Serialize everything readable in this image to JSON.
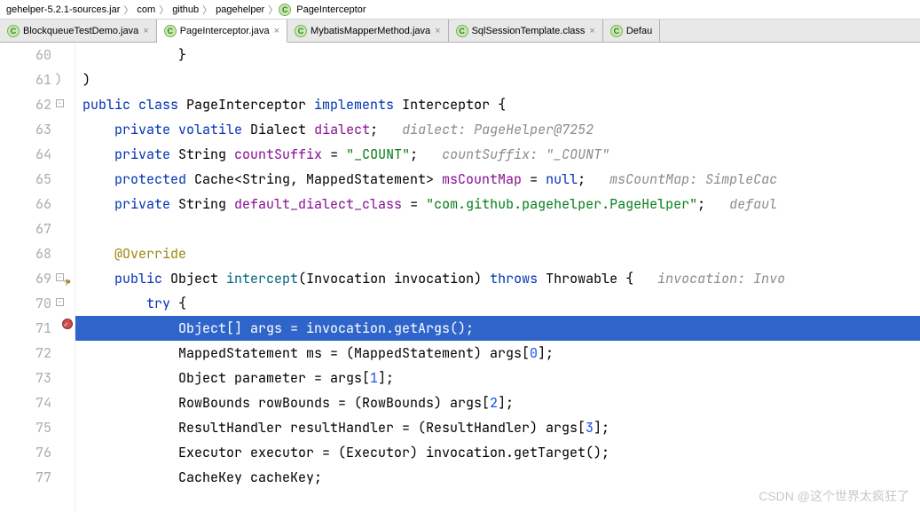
{
  "breadcrumb": {
    "items": [
      "gehelper-5.2.1-sources.jar",
      "com",
      "github",
      "pagehelper",
      "PageInterceptor"
    ]
  },
  "tabs": [
    {
      "label": "BlockqueueTestDemo.java",
      "active": false
    },
    {
      "label": "PageInterceptor.java",
      "active": true
    },
    {
      "label": "MybatisMapperMethod.java",
      "active": false
    },
    {
      "label": "SqlSessionTemplate.class",
      "active": false
    },
    {
      "label": "Defau",
      "active": false,
      "truncated": true
    }
  ],
  "lines": {
    "60": {
      "indent": 12,
      "tokens": [
        {
          "t": "}",
          "c": ""
        }
      ]
    },
    "61": {
      "indent": 0,
      "closer": ")",
      "tokens": [
        {
          "t": ")",
          "c": ""
        }
      ]
    },
    "62": {
      "indent": 0,
      "tokens": [
        {
          "t": "public ",
          "c": "kw"
        },
        {
          "t": "class ",
          "c": "kw"
        },
        {
          "t": "PageInterceptor ",
          "c": "type"
        },
        {
          "t": "implements ",
          "c": "kw"
        },
        {
          "t": "Interceptor ",
          "c": "type"
        },
        {
          "t": "{",
          "c": ""
        }
      ]
    },
    "63": {
      "indent": 4,
      "tokens": [
        {
          "t": "private ",
          "c": "kw"
        },
        {
          "t": "volatile ",
          "c": "kw"
        },
        {
          "t": "Dialect ",
          "c": "type"
        },
        {
          "t": "dialect",
          "c": "field"
        },
        {
          "t": ";   ",
          "c": ""
        },
        {
          "t": "dialect: PageHelper@7252",
          "c": "cmt"
        }
      ]
    },
    "64": {
      "indent": 4,
      "tokens": [
        {
          "t": "private ",
          "c": "kw"
        },
        {
          "t": "String ",
          "c": "type"
        },
        {
          "t": "countSuffix",
          "c": "field"
        },
        {
          "t": " = ",
          "c": ""
        },
        {
          "t": "\"_COUNT\"",
          "c": "str"
        },
        {
          "t": ";   ",
          "c": ""
        },
        {
          "t": "countSuffix: \"_COUNT\"",
          "c": "cmt"
        }
      ]
    },
    "65": {
      "indent": 4,
      "tokens": [
        {
          "t": "protected ",
          "c": "kw"
        },
        {
          "t": "Cache<String, MappedStatement> ",
          "c": "type"
        },
        {
          "t": "msCountMap",
          "c": "field"
        },
        {
          "t": " = ",
          "c": ""
        },
        {
          "t": "null",
          "c": "kw"
        },
        {
          "t": ";   ",
          "c": ""
        },
        {
          "t": "msCountMap: SimpleCac",
          "c": "cmt"
        }
      ]
    },
    "66": {
      "indent": 4,
      "tokens": [
        {
          "t": "private ",
          "c": "kw"
        },
        {
          "t": "String ",
          "c": "type"
        },
        {
          "t": "default_dialect_class",
          "c": "field"
        },
        {
          "t": " = ",
          "c": ""
        },
        {
          "t": "\"com.github.pagehelper.PageHelper\"",
          "c": "str"
        },
        {
          "t": ";   ",
          "c": ""
        },
        {
          "t": "defaul",
          "c": "cmt"
        }
      ]
    },
    "67": {
      "indent": 0,
      "tokens": []
    },
    "68": {
      "indent": 4,
      "tokens": [
        {
          "t": "@Override",
          "c": "anno"
        }
      ]
    },
    "69": {
      "indent": 4,
      "marker": "override",
      "tokens": [
        {
          "t": "public ",
          "c": "kw"
        },
        {
          "t": "Object ",
          "c": "type"
        },
        {
          "t": "intercept",
          "c": "method"
        },
        {
          "t": "(Invocation invocation) ",
          "c": ""
        },
        {
          "t": "throws ",
          "c": "kw"
        },
        {
          "t": "Throwable {   ",
          "c": ""
        },
        {
          "t": "invocation: Invo",
          "c": "cmt"
        }
      ]
    },
    "70": {
      "indent": 8,
      "tokens": [
        {
          "t": "try ",
          "c": "kw"
        },
        {
          "t": "{",
          "c": ""
        }
      ]
    },
    "71": {
      "indent": 12,
      "marker": "breakpoint",
      "selected": true,
      "tokens": [
        {
          "t": "Object[] args = invocation.getArgs();",
          "c": ""
        }
      ]
    },
    "72": {
      "indent": 12,
      "tokens": [
        {
          "t": "MappedStatement ms = (MappedStatement) args[",
          "c": ""
        },
        {
          "t": "0",
          "c": "num"
        },
        {
          "t": "];",
          "c": ""
        }
      ]
    },
    "73": {
      "indent": 12,
      "tokens": [
        {
          "t": "Object parameter = args[",
          "c": ""
        },
        {
          "t": "1",
          "c": "num"
        },
        {
          "t": "];",
          "c": ""
        }
      ]
    },
    "74": {
      "indent": 12,
      "tokens": [
        {
          "t": "RowBounds rowBounds = (RowBounds) args[",
          "c": ""
        },
        {
          "t": "2",
          "c": "num"
        },
        {
          "t": "];",
          "c": ""
        }
      ]
    },
    "75": {
      "indent": 12,
      "tokens": [
        {
          "t": "ResultHandler resultHandler = (ResultHandler) args[",
          "c": ""
        },
        {
          "t": "3",
          "c": "num"
        },
        {
          "t": "];",
          "c": ""
        }
      ]
    },
    "76": {
      "indent": 12,
      "tokens": [
        {
          "t": "Executor executor = (Executor) invocation.getTarget();",
          "c": ""
        }
      ]
    },
    "77": {
      "indent": 12,
      "tokens": [
        {
          "t": "CacheKey cacheKey;",
          "c": ""
        }
      ]
    }
  },
  "lineOrder": [
    "60",
    "61",
    "62",
    "63",
    "64",
    "65",
    "66",
    "67",
    "68",
    "69",
    "70",
    "71",
    "72",
    "73",
    "74",
    "75",
    "76",
    "77"
  ],
  "watermark": "CSDN @这个世界太疯狂了"
}
